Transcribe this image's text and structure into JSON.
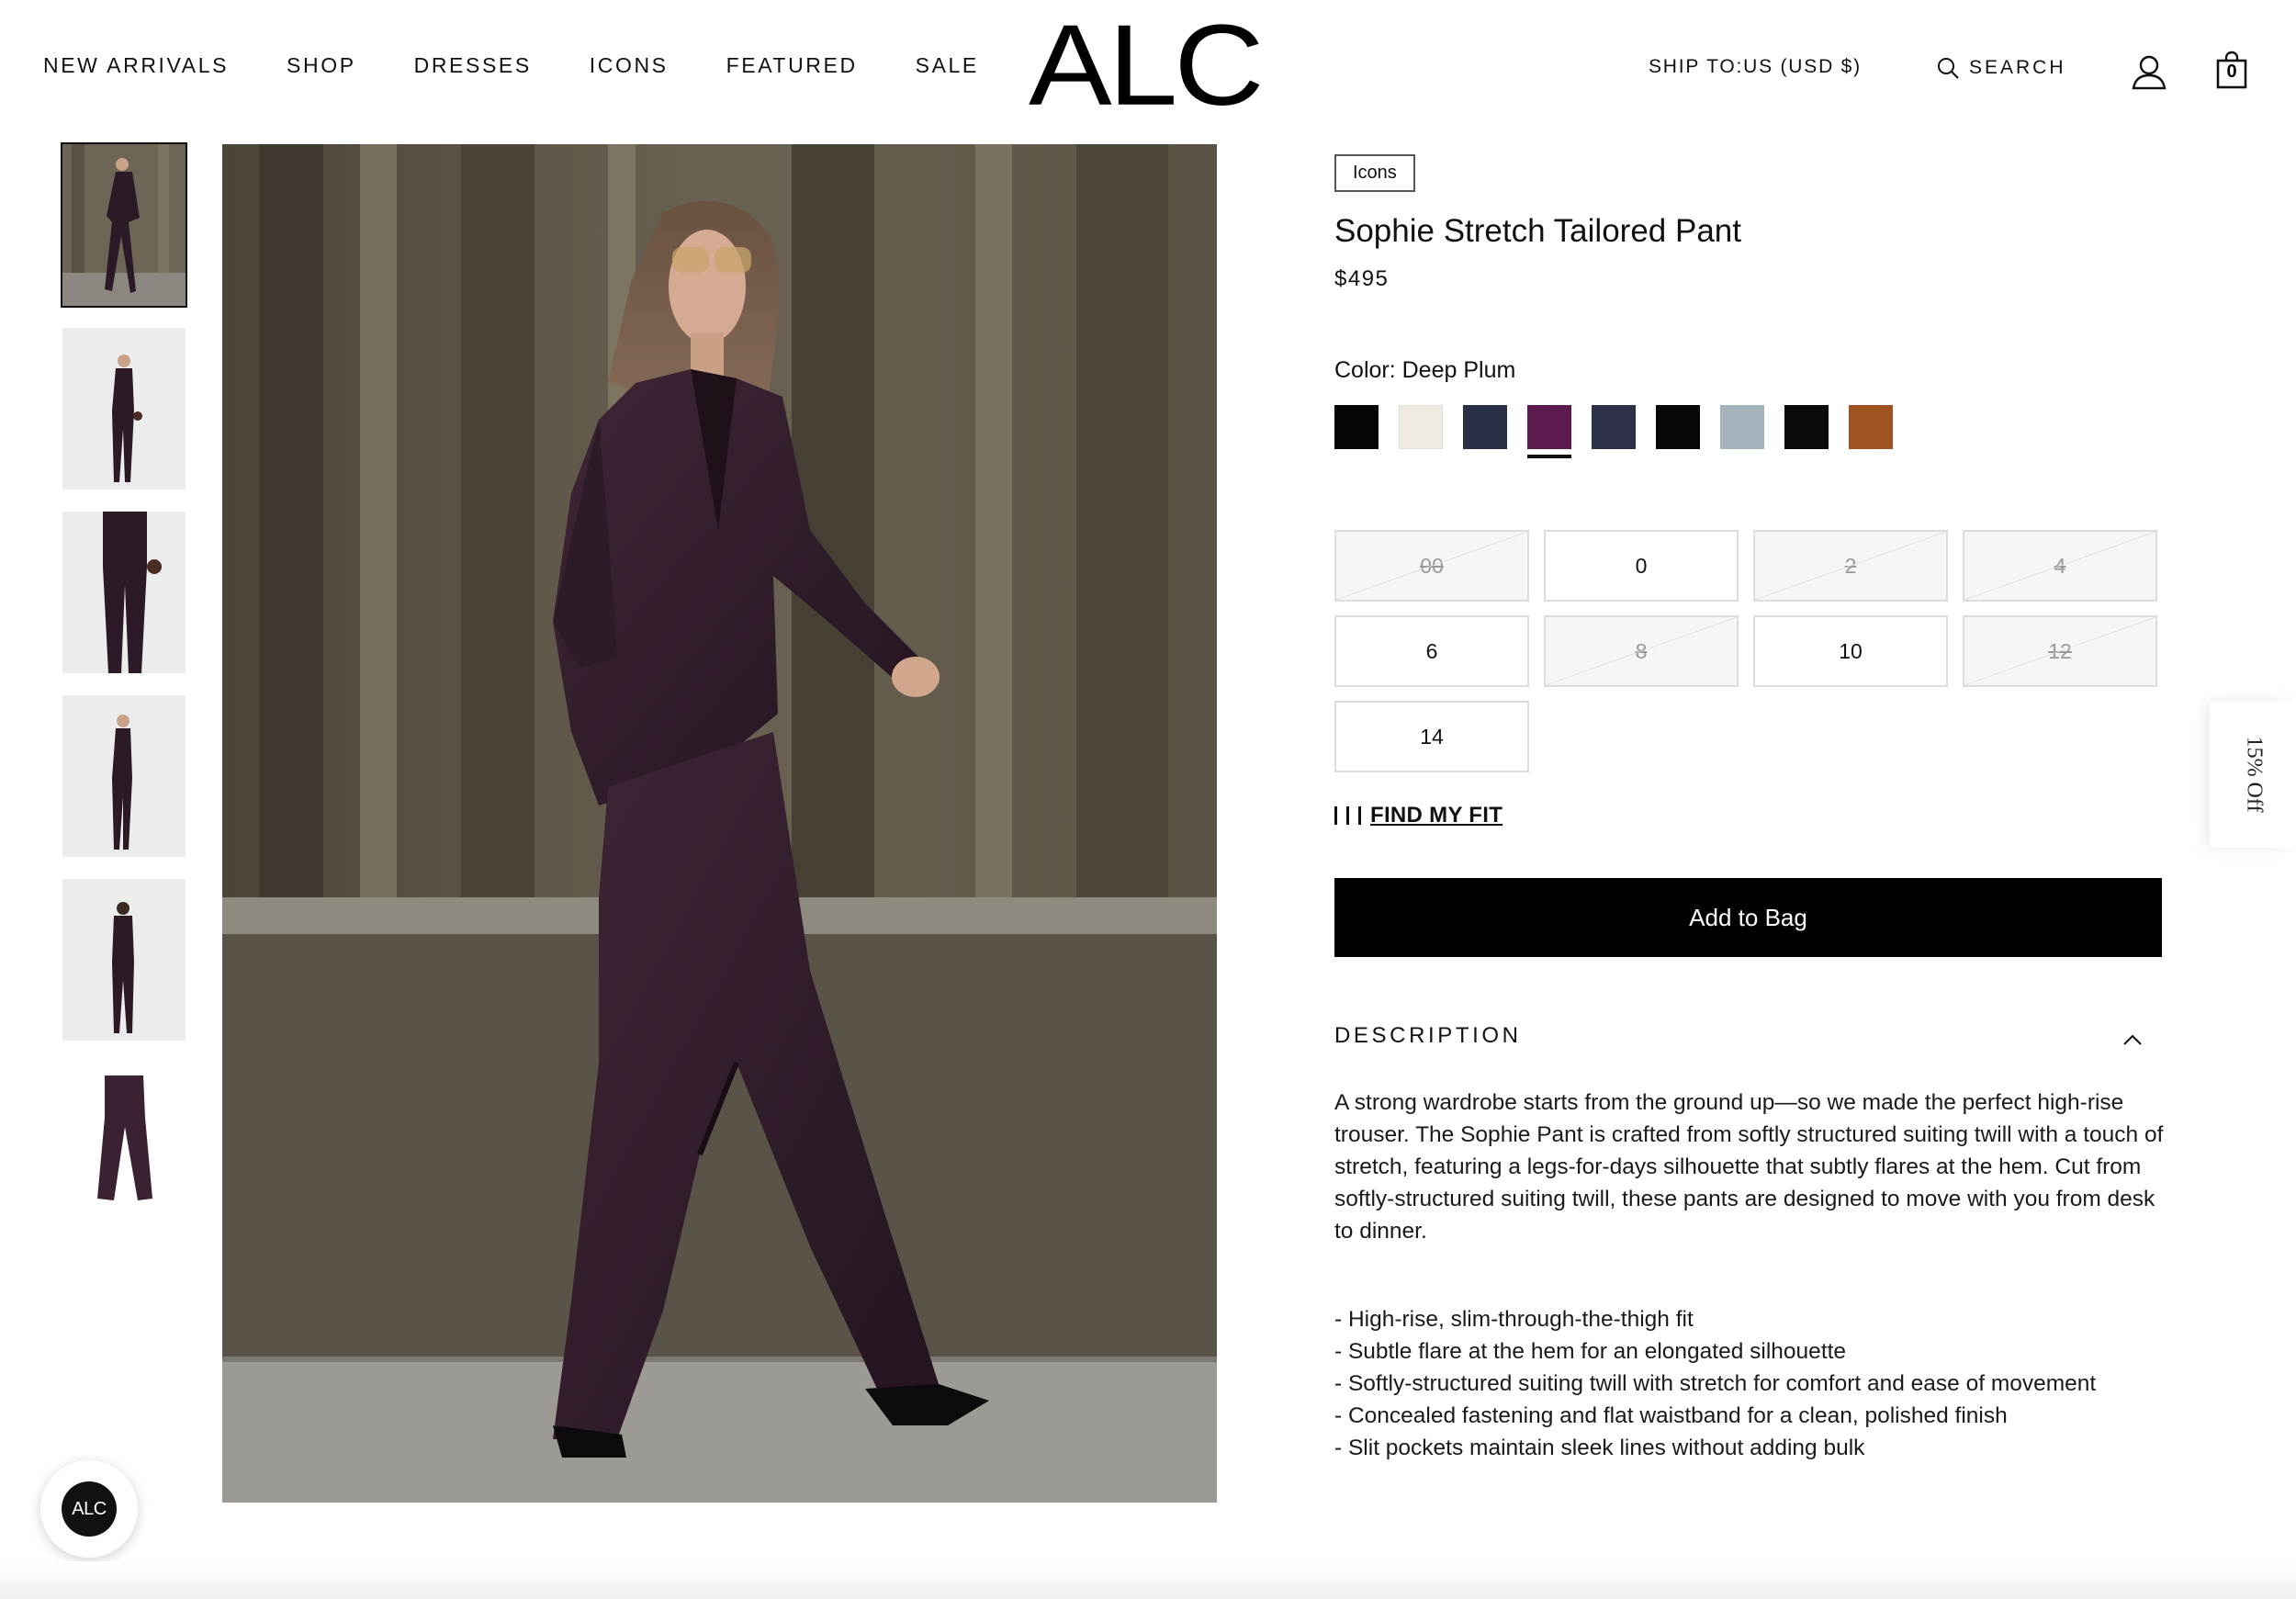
{
  "header": {
    "nav": [
      {
        "label": "NEW ARRIVALS"
      },
      {
        "label": "SHOP"
      },
      {
        "label": "DRESSES"
      },
      {
        "label": "ICONS"
      },
      {
        "label": "FEATURED"
      },
      {
        "label": "SALE"
      }
    ],
    "logo": "ALC",
    "ship_to": "SHIP TO:US (USD $)",
    "search_label": "SEARCH",
    "bag_count": "0",
    "icons": [
      "search-icon",
      "account-icon",
      "shopping-bag-icon"
    ]
  },
  "gallery": {
    "thumbnail_count": 6,
    "selected_index": 0,
    "main_image": "model walking in deep plum tailored suit"
  },
  "product": {
    "collection_tag": "Icons",
    "title": "Sophie Stretch Tailored Pant",
    "price": "$495",
    "color_label": "Color: Deep Plum",
    "swatches": [
      {
        "color": "#050505",
        "selected": false
      },
      {
        "color": "#efebe2",
        "selected": false
      },
      {
        "color": "#2b2f45",
        "selected": false
      },
      {
        "color": "#5c1a4f",
        "selected": true
      },
      {
        "color": "#2e3048",
        "selected": false
      },
      {
        "color": "#070707",
        "selected": false
      },
      {
        "color": "#a4b3bb",
        "selected": false
      },
      {
        "color": "#0a0a0a",
        "selected": false
      },
      {
        "color": "#a05322",
        "selected": false
      }
    ],
    "sizes": [
      {
        "label": "00",
        "available": false
      },
      {
        "label": "0",
        "available": true
      },
      {
        "label": "2",
        "available": false
      },
      {
        "label": "4",
        "available": false
      },
      {
        "label": "6",
        "available": true
      },
      {
        "label": "8",
        "available": false
      },
      {
        "label": "10",
        "available": true
      },
      {
        "label": "12",
        "available": false
      },
      {
        "label": "14",
        "available": true
      }
    ],
    "fit_link": "FIND MY FIT",
    "add_to_bag": "Add to Bag"
  },
  "description": {
    "title": "DESCRIPTION",
    "body": "A strong wardrobe starts from the ground up—so we made the perfect high-rise trouser. The Sophie Pant is crafted from softly structured suiting twill with a touch of stretch, featuring a legs-for-days silhouette that subtly flares at the hem. Cut from softly-structured suiting twill, these pants are designed to move with you from desk to dinner.",
    "bullets": [
      "- High-rise, slim-through-the-thigh fit",
      "- Subtle flare at the hem for an elongated silhouette",
      "- Softly-structured suiting twill with stretch for comfort and ease of movement",
      "- Concealed fastening and flat waistband for a clean, polished finish",
      "- Slit pockets maintain sleek lines without adding bulk"
    ]
  },
  "promo_tab": "15% Off",
  "chat_badge": "ALC",
  "colors": {
    "accent": "#000000",
    "suit_plum": "#3a2233",
    "oos_fill": "#f6f6f6"
  }
}
